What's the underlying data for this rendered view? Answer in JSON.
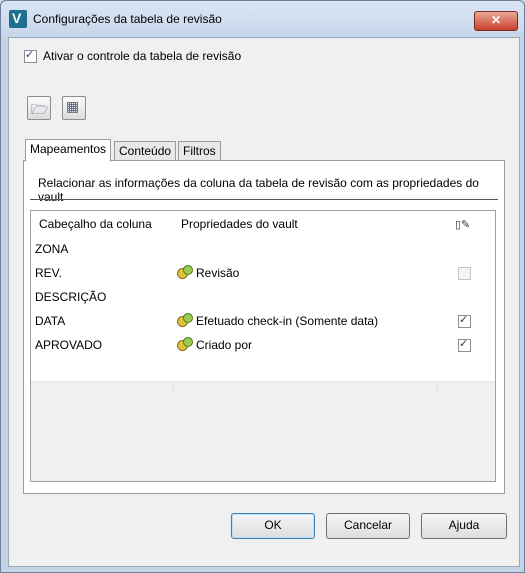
{
  "window": {
    "title": "Configurações da tabela de revisão",
    "close_label": "✕"
  },
  "enable_checkbox": {
    "label": "Ativar o controle da tabela de revisão",
    "checked": true
  },
  "toolbar": {
    "open_icon": "open-folder-icon",
    "table_icon": "table-settings-icon"
  },
  "tabs": [
    {
      "label": "Mapeamentos"
    },
    {
      "label": "Conteúdo"
    },
    {
      "label": "Filtros"
    }
  ],
  "mapping": {
    "description": "Relacionar as informações da coluna da tabela de revisão com as propriedades do vault",
    "columns": {
      "header": "Cabeçalho da coluna",
      "property": "Propriedades do vault",
      "editable_icon": "edit-column-icon"
    },
    "rows": [
      {
        "header": "ZONA",
        "property": "",
        "checkbox": "none"
      },
      {
        "header": "REV.",
        "property": "Revisão",
        "checkbox": "disabled"
      },
      {
        "header": "DESCRIÇÃO",
        "property": "",
        "checkbox": "none"
      },
      {
        "header": "DATA",
        "property": "Efetuado check-in (Somente data)",
        "checkbox": "checked"
      },
      {
        "header": "APROVADO",
        "property": "Criado por",
        "checkbox": "checked"
      },
      {
        "header": "",
        "property": "",
        "checkbox": "none"
      }
    ]
  },
  "buttons": {
    "ok": "OK",
    "cancel": "Cancelar",
    "help": "Ajuda"
  }
}
